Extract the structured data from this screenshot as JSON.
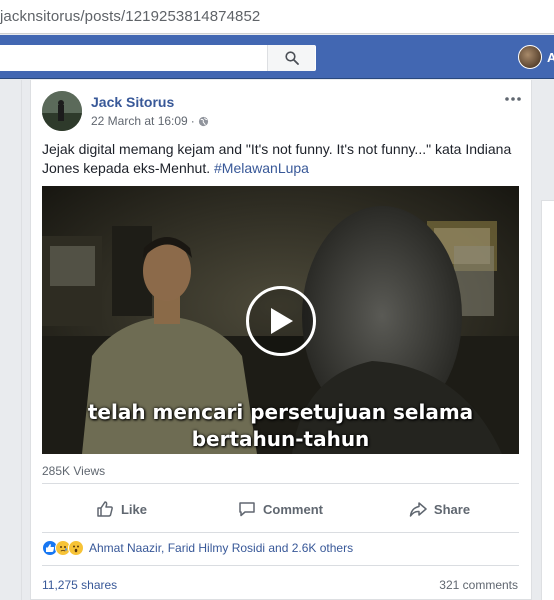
{
  "browser": {
    "url": "jacknsitorus/posts/1219253814874852"
  },
  "topbar": {
    "search_placeholder": "",
    "user_initial": "A"
  },
  "post": {
    "author": "Jack Sitorus",
    "timestamp": "22 March at 16:09",
    "separator": "·",
    "caption": "Jejak digital memang kejam and \"It's not funny. It's not funny...\" kata Indiana Jones kepada eks-Menhut. ",
    "hashtag": "#MelawanLupa",
    "video": {
      "subtitle_line1": "telah mencari persetujuan selama",
      "subtitle_line2": "bertahun-tahun"
    },
    "views": "285K Views",
    "actions": {
      "like": "Like",
      "comment": "Comment",
      "share": "Share"
    },
    "reactions_text": "Ahmat Naazir, Farid Hilmy Rosidi and 2.6K others",
    "shares": "11,275 shares",
    "comments": "321 comments"
  },
  "colors": {
    "brand": "#4267b2",
    "link": "#385898",
    "muted": "#606770"
  },
  "icons": [
    "search-icon",
    "more-icon",
    "globe-icon",
    "play-icon",
    "like-icon",
    "comment-icon",
    "share-icon",
    "like-reaction-icon",
    "sad-reaction-icon",
    "wow-reaction-icon"
  ]
}
